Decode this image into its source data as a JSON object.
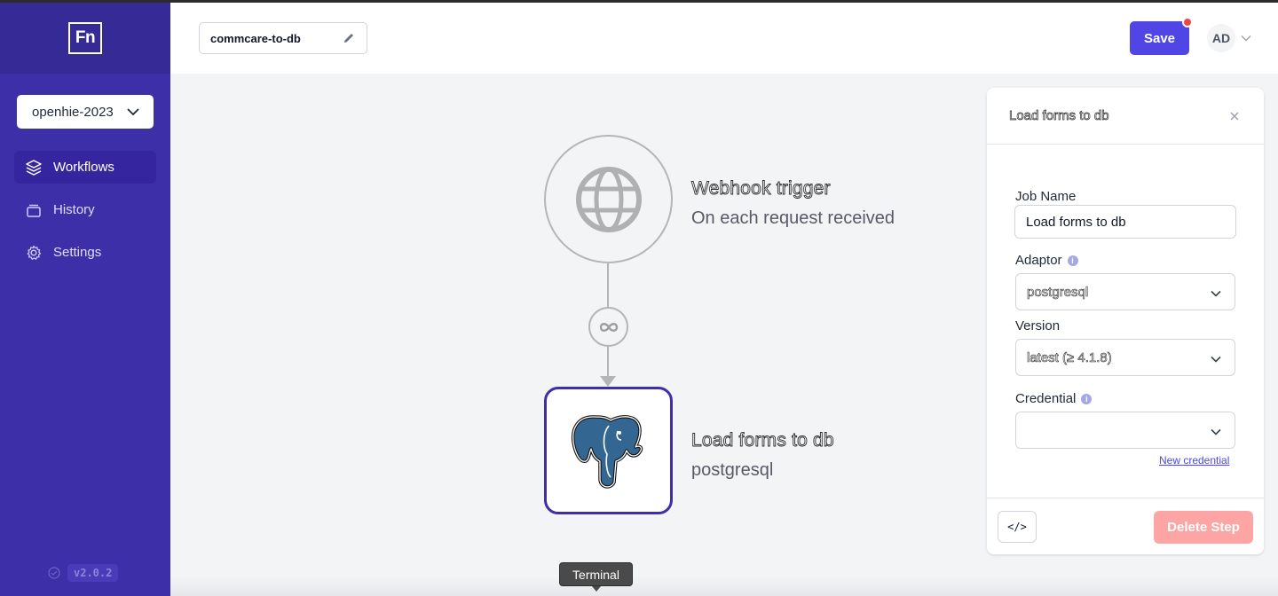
{
  "sidebar": {
    "logo": "Fn",
    "project": "openhie-2023",
    "nav": [
      {
        "label": "Workflows",
        "icon": "layers-icon",
        "active": true
      },
      {
        "label": "History",
        "icon": "archive-icon",
        "active": false
      },
      {
        "label": "Settings",
        "icon": "gear-icon",
        "active": false
      }
    ],
    "version": "v2.0.2"
  },
  "header": {
    "workflow_name": "commcare-to-db",
    "save_label": "Save",
    "avatar_initials": "AD"
  },
  "canvas": {
    "trigger": {
      "title": "Webhook trigger",
      "subtitle": "On each request received",
      "icon": "globe-icon"
    },
    "edge_icon": "infinity-icon",
    "job": {
      "title": "Load forms to db",
      "subtitle": "postgresql",
      "icon": "postgresql-elephant-icon"
    }
  },
  "panel": {
    "title": "Load forms to db",
    "job_name_label": "Job Name",
    "job_name_value": "Load forms to db",
    "adaptor_label": "Adaptor",
    "adaptor_value": "postgresql",
    "version_label": "Version",
    "version_value": "latest (≥ 4.1.8)",
    "credential_label": "Credential",
    "credential_value": "",
    "new_credential_link": "New credential",
    "code_button": "</>",
    "delete_button": "Delete Step"
  },
  "footer": {
    "terminal_tooltip": "Terminal"
  },
  "colors": {
    "sidebar": "#3d2fa8",
    "accent": "#4f46e5",
    "danger_disabled": "#fda4a4"
  }
}
